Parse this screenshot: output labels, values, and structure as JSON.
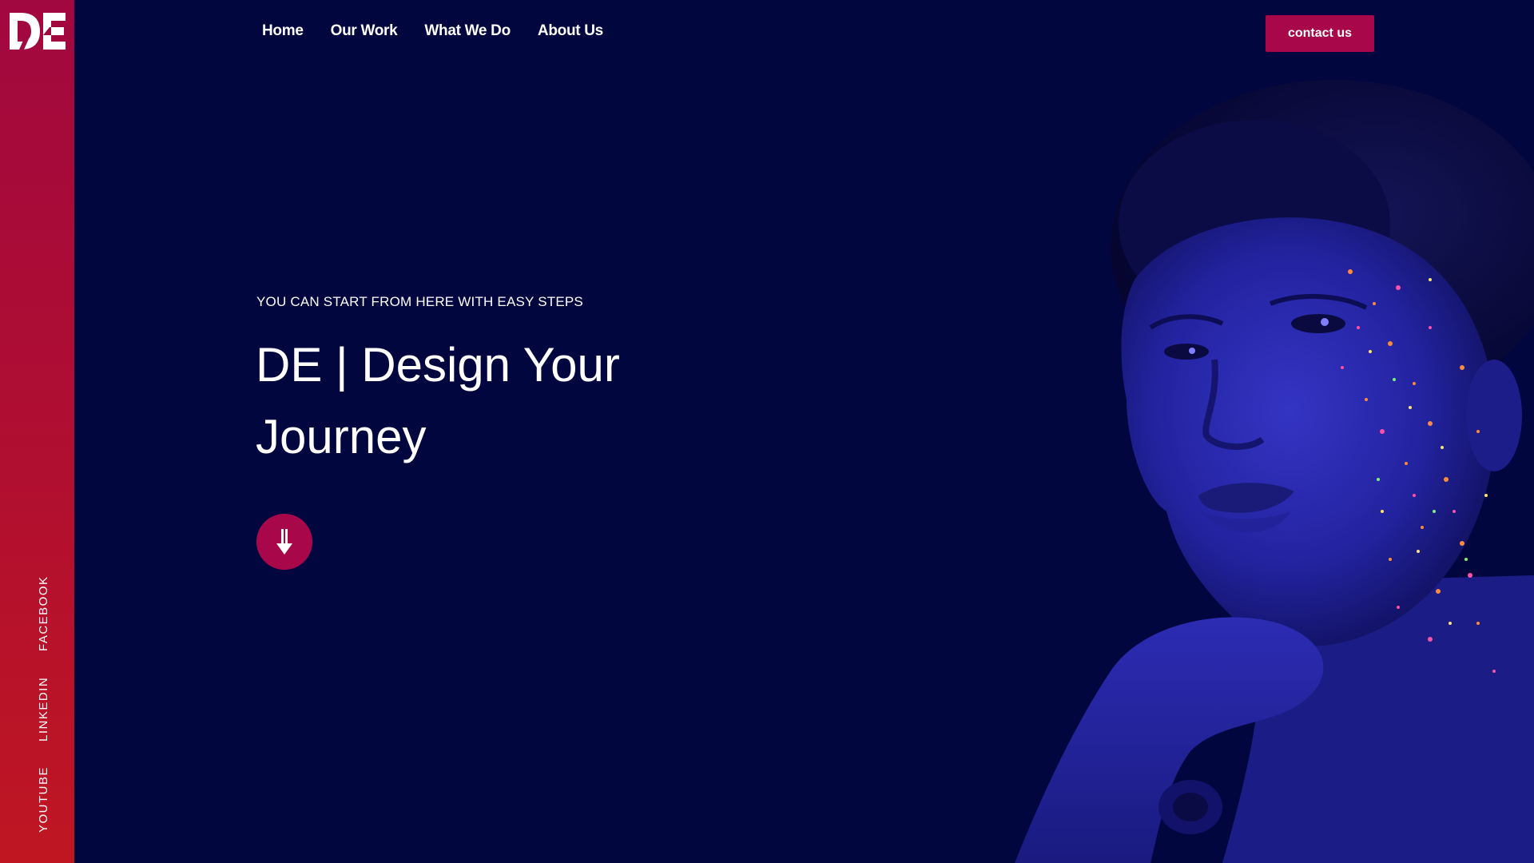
{
  "brand": {
    "logo_text": "DE"
  },
  "nav": {
    "items": [
      {
        "label": "Home"
      },
      {
        "label": "Our Work"
      },
      {
        "label": "What We Do"
      },
      {
        "label": "About Us"
      }
    ],
    "contact_label": "contact us"
  },
  "hero": {
    "eyebrow": "YOU CAN START FROM HERE WITH EASY STEPS",
    "headline": "DE | Design Your Journey"
  },
  "social": {
    "facebook": "FACEBOOK",
    "linkedin": "LINKEDIN",
    "youtube": "YOUTUBE"
  },
  "icons": {
    "scroll": "arrow-down-icon",
    "logo": "de-logo-icon",
    "hero_image": "glitter-face-portrait"
  },
  "colors": {
    "background": "#02063f",
    "accent": "#a8084a",
    "sidebar_top": "#a1083f",
    "sidebar_bottom": "#bf1622",
    "text": "#ffffff",
    "portrait": "#2a2aa8"
  }
}
